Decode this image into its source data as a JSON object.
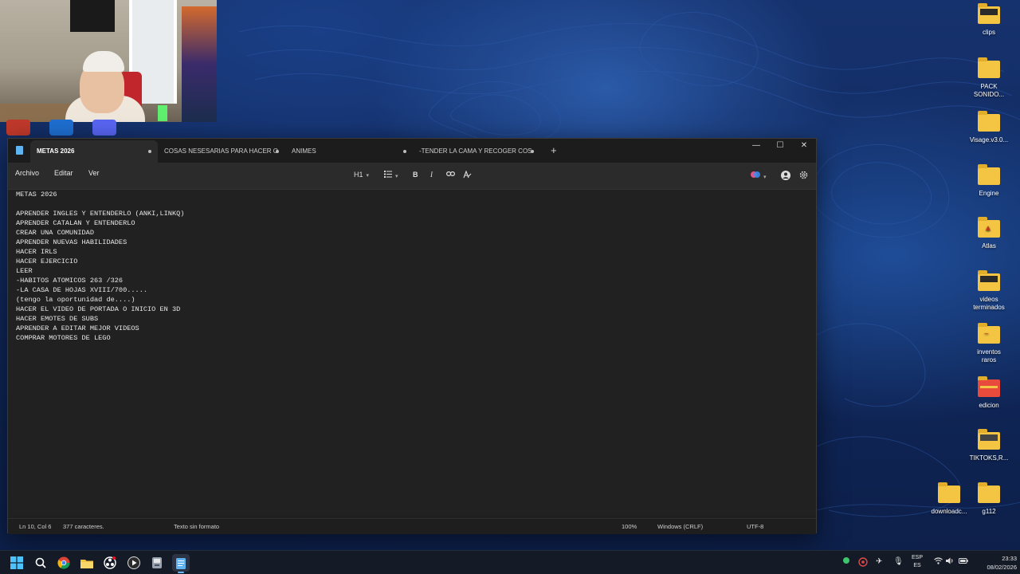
{
  "notepad": {
    "tabs": [
      {
        "label": "METAS 2026",
        "active": true
      },
      {
        "label": "COSAS NESESARIAS PARA HACER O",
        "active": false
      },
      {
        "label": "ANIMES",
        "active": false
      },
      {
        "label": "-TENDER LA CAMA Y RECOGER COS",
        "active": false
      }
    ],
    "add_tab": "+",
    "window_controls": {
      "minimize": "—",
      "maximize": "☐",
      "close": "✕"
    },
    "menu": {
      "file": "Archivo",
      "edit": "Editar",
      "view": "Ver"
    },
    "toolbar": {
      "heading": "H1",
      "list_icon": "list-icon",
      "bold": "B",
      "italic": "I",
      "link_icon": "link-icon",
      "clear_format_icon": "clear-format-icon"
    },
    "content_lines": [
      "METAS 2026",
      "",
      "APRENDER INGLES Y ENTENDERLO (ANKI,LINKQ)",
      "APRENDER CATALAN Y ENTENDERLO",
      "CREAR UNA COMUNIDAD",
      "APRENDER NUEVAS HABILIDADES",
      "HACER IRLS",
      "HACER EJERCICIO",
      "LEER",
      "-HABITOS ATOMICOS 263 /326",
      "-LA CASA DE HOJAS XVIII/700.....",
      "(tengo la oportunidad de....)",
      "HACER EL VIDEO DE PORTADA O INICIO EN 3D",
      "HACER EMOTES DE SUBS",
      "APRENDER A EDITAR MEJOR VIDEOS",
      "COMPRAR MOTORES DE LEGO"
    ],
    "status": {
      "position": "Ln 10, Col 6",
      "chars": "377 caracteres.",
      "format": "Texto sin formato",
      "zoom": "100%",
      "line_endings": "Windows (CRLF)",
      "encoding": "UTF-8"
    }
  },
  "desktop_icons": [
    {
      "label": "clips"
    },
    {
      "label": "PACK SONIDO..."
    },
    {
      "label": "Visage.v3.0..."
    },
    {
      "label": "Engine"
    },
    {
      "label": "Atlas"
    },
    {
      "label": "videos terminados"
    },
    {
      "label": "inventos raros"
    },
    {
      "label": "edicion"
    },
    {
      "label": "TIKTOKS,R..."
    },
    {
      "label": "downloadc..."
    },
    {
      "label": "g112"
    }
  ],
  "taskbar": {
    "language": {
      "line1": "ESP",
      "line2": "ES"
    },
    "time": "23:33",
    "date": "08/02/2026"
  },
  "colors": {
    "accent": "#60b6ff",
    "folder": "#f4c542",
    "window_bg": "#202020"
  }
}
